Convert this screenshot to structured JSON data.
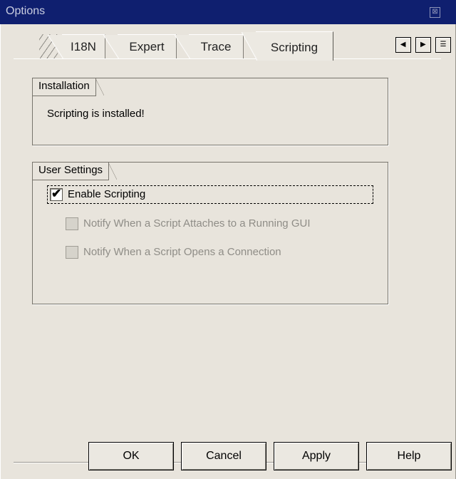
{
  "window": {
    "title": "Options",
    "close_glyph": "⊠"
  },
  "tabs": [
    {
      "label": "I18N"
    },
    {
      "label": "Expert"
    },
    {
      "label": "Trace"
    },
    {
      "label": "Scripting",
      "active": true
    }
  ],
  "tab_nav": {
    "left_glyph": "◀",
    "right_glyph": "▶",
    "list_glyph": "☰"
  },
  "installation": {
    "heading": "Installation",
    "status": "Scripting is installed!"
  },
  "user_settings": {
    "heading": "User Settings",
    "enable_scripting": {
      "label": "Enable Scripting",
      "checked": true,
      "check_glyph": "✔"
    },
    "notify_attach": {
      "label": "Notify When a Script Attaches to a Running GUI",
      "checked": false,
      "enabled": false
    },
    "notify_connection": {
      "label": "Notify When a Script Opens a Connection",
      "checked": false,
      "enabled": false
    }
  },
  "buttons": {
    "ok": "OK",
    "cancel": "Cancel",
    "apply": "Apply",
    "help": "Help"
  }
}
